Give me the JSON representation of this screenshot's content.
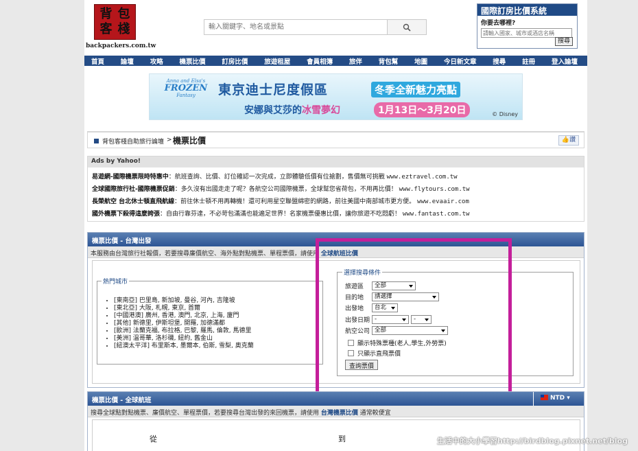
{
  "logo": {
    "chars": [
      "背",
      "包",
      "客",
      "棧"
    ],
    "site": "backpackers.com.tw"
  },
  "search": {
    "placeholder": "輸入關鍵字、地名或景點"
  },
  "hotel": {
    "title": "國際訂房比價系統",
    "label": "你要去哪裡?",
    "placeholder": "請輸入國家、城市或酒店名稱",
    "button": "搜尋"
  },
  "nav": [
    "首頁",
    "論壇",
    "攻略",
    "機票比價",
    "訂房比價",
    "旅遊租屋",
    "會員相簿",
    "旅伴",
    "背包幫",
    "地圖",
    "今日新文章",
    "搜尋",
    "註冊",
    "登入論壇"
  ],
  "banner": {
    "f1": "Anna and Elsa's",
    "f2": "FROZEN",
    "f3": "Fantasy",
    "line1": "東京迪士尼度假區",
    "tag": "冬季全新魅力亮點",
    "line2a": "安娜與艾莎的",
    "line2b": "冰雪夢幻",
    "dates": "1月13日～3月20日",
    "copy": "© Disney"
  },
  "breadcrumb": {
    "link": "背包客棧自助旅行論壇",
    "sep": ">",
    "title": "機票比價",
    "like": "讚"
  },
  "ads": {
    "header": "Ads by Yahoo!",
    "items": [
      {
        "t": "易遊網-國際機票限時特惠中",
        "d": "：航班查詢、比價、訂位確認一次完成，立即體驗低價有位搶劃，售價無可挑戰",
        "u": "www.eztravel.com.tw"
      },
      {
        "t": "全球國際旅行社-國際機票促銷",
        "d": "：多久沒有出國走走了呢？各航空公司國際機票，全球幫您省荷包，不用再比價！",
        "u": "www.flytours.com.tw"
      },
      {
        "t": "長榮航空 台北休士頓直飛航線",
        "d": "：前往休士頓不用再轉機！還可利用星空聯盟綿密的網路，前往美國中南部城市更方便。",
        "u": "www.evaair.com"
      },
      {
        "t": "國外機票下殺得這麼誇張",
        "d": "：自由行靠芬達，不必苛包滿滿也能遍足世界！名家機票優惠比價，讓你旅遊不吃悶虧！",
        "u": "www.fantast.com.tw"
      }
    ]
  },
  "taiwan": {
    "header": "機票比價 - 台灣出發",
    "intro": "本服務由台灣旅行社報價，若要搜尋廉價航空、海外點對點機票、單程票價，請使用",
    "intro_link": "全球航班比價",
    "hot_legend": "熱門城市",
    "hot": [
      "[東南亞] 巴里島, 新加坡, 曼谷, 河內, 吉隆坡",
      "[東北亞] 大阪, 札幌, 東京, 首爾",
      "[中國港澳] 廣州, 香港, 澳門, 北京, 上海, 廈門",
      "[其他] 新德里, 伊斯坦堡, 開羅, 加德滿都",
      "[歐洲] 法蘭克福, 布拉格, 巴黎, 羅馬, 倫敦, 馬德里",
      "[美洲] 溫哥華, 洛杉磯, 紐約, 舊金山",
      "[紐澳太平洋] 布里斯本, 墨爾本, 伯斯, 雪梨, 奧克蘭"
    ],
    "sel_legend": "選擇搜尋條件",
    "f_region": "旅遊區",
    "v_region": "全部",
    "f_dest": "目的地",
    "v_dest": "請選擇",
    "f_origin": "出發地",
    "v_origin": "台北",
    "f_date": "出發日期",
    "v_date1": "-",
    "v_date2": "-",
    "f_airline": "航空公司",
    "v_airline": "全部",
    "c1": "顯示特殊票種(老人,學生,外勞票)",
    "c2": "只顯示直飛票價",
    "button": "查詢票價"
  },
  "global": {
    "header": "機票比價 - 全球航班",
    "currency": "NTD",
    "intro": "搜尋全球點對點機票、廉價航空、單程票價，若要搜尋台灣出發的來回機票，請使用",
    "intro_link": "台灣機票比價",
    "intro_tail": "通常較便宜",
    "from": "從",
    "to": "到"
  },
  "watermark": "生活中的大小學習http://birdblog.pixnet.net/blog"
}
